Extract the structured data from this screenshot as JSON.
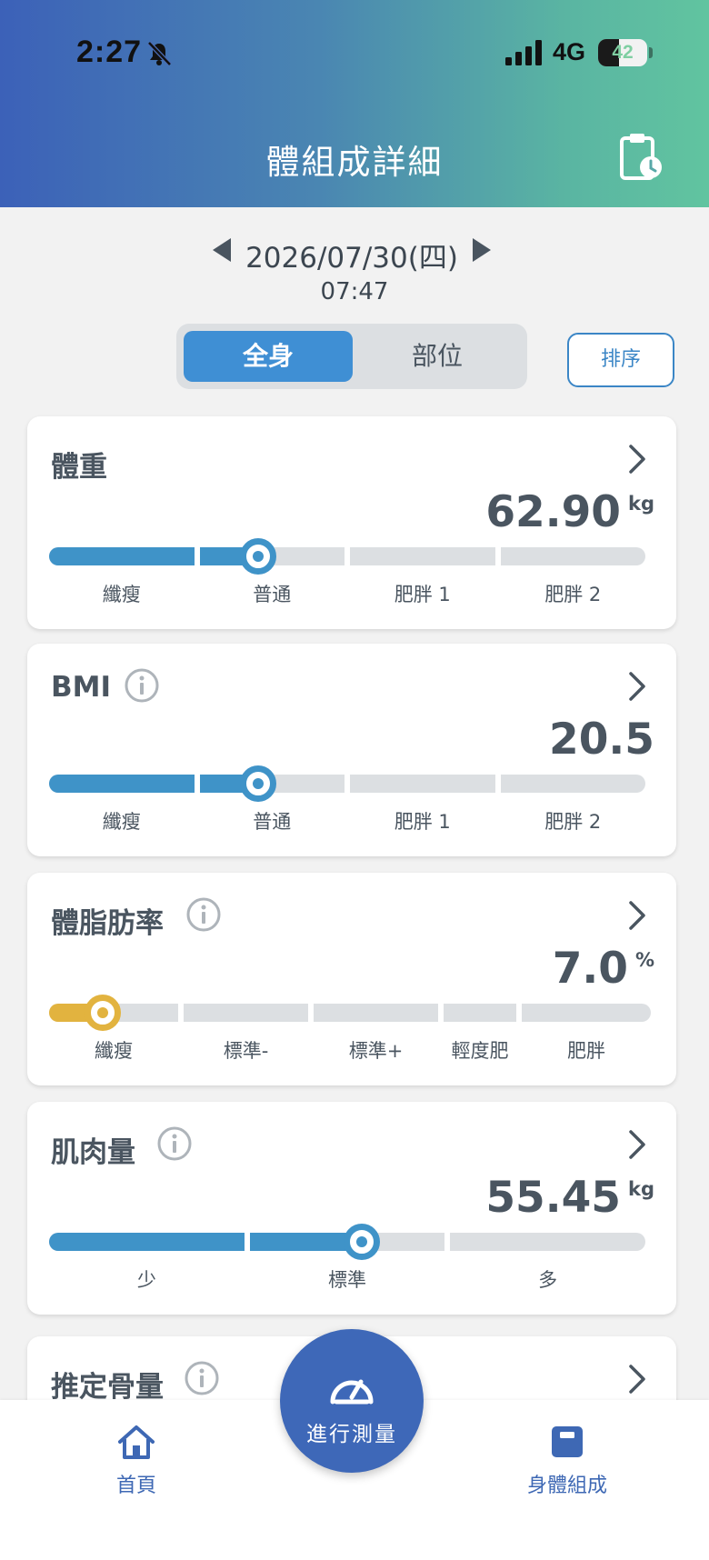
{
  "status_bar": {
    "time": "2:27",
    "network": "4G",
    "battery": "42",
    "battery_level": 0.42
  },
  "header": {
    "title": "體組成詳細"
  },
  "date_nav": {
    "date": "2026/07/30(四)",
    "time": "07:47"
  },
  "segment": {
    "active_label": "全身",
    "inactive_label": "部位"
  },
  "sort_label": "排序",
  "metrics": [
    {
      "title": "體重",
      "value": "62.90",
      "unit": "kg",
      "has_info": false,
      "segments": [
        "纖瘦",
        "普通",
        "肥胖 1",
        "肥胖 2"
      ],
      "active_segment": 1,
      "marker_fraction": 0.35,
      "color": "#3f93c8"
    },
    {
      "title": "BMI",
      "value": "20.5",
      "unit": "",
      "has_info": true,
      "segments": [
        "纖瘦",
        "普通",
        "肥胖 1",
        "肥胖 2"
      ],
      "active_segment": 1,
      "marker_fraction": 0.35,
      "color": "#3f93c8"
    },
    {
      "title": "體脂肪率",
      "value": "7.0",
      "unit": "%",
      "has_info": true,
      "segments": [
        "纖瘦",
        "標準-",
        "標準+",
        "輕度肥",
        "肥胖"
      ],
      "active_segment": 0,
      "marker_fraction": 0.09,
      "color": "#e2b33f"
    },
    {
      "title": "肌肉量",
      "value": "55.45",
      "unit": "kg",
      "has_info": true,
      "segments": [
        "少",
        "標準",
        "多"
      ],
      "active_segment": 1,
      "marker_fraction": 0.525,
      "color": "#3f93c8"
    }
  ],
  "partial_card": {
    "title": "推定骨量"
  },
  "bottom_nav": {
    "home_label": "首頁",
    "measure_label": "進行測量",
    "body_label": "身體組成"
  }
}
